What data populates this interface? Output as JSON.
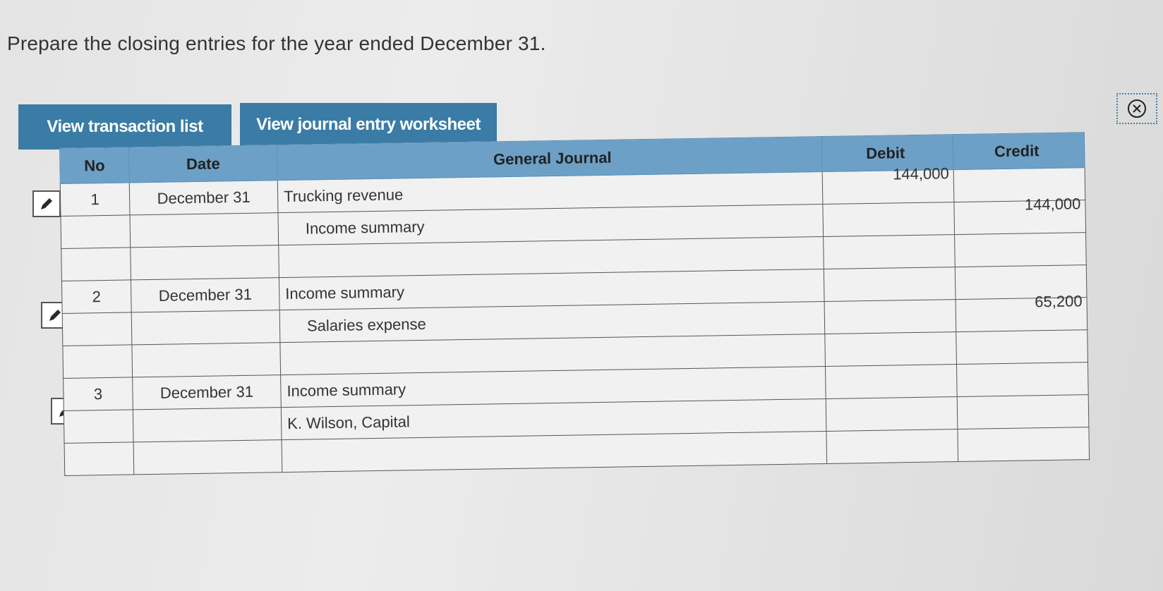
{
  "prompt": "Prepare the closing entries for the year ended December 31.",
  "buttons": {
    "transaction_list": "View transaction list",
    "journal_worksheet": "View journal entry worksheet"
  },
  "table": {
    "headers": {
      "no": "No",
      "date": "Date",
      "journal": "General Journal",
      "debit": "Debit",
      "credit": "Credit"
    },
    "rows": [
      {
        "no": "1",
        "date": "December 31",
        "account": "Trucking revenue",
        "debit": "144,000",
        "credit": ""
      },
      {
        "no": "",
        "date": "",
        "account": "Income summary",
        "debit": "",
        "credit": "144,000"
      },
      {
        "no": "",
        "date": "",
        "account": "",
        "debit": "",
        "credit": ""
      },
      {
        "no": "2",
        "date": "December 31",
        "account": "Income summary",
        "debit": "",
        "credit": ""
      },
      {
        "no": "",
        "date": "",
        "account": "Salaries expense",
        "debit": "",
        "credit": "65,200"
      },
      {
        "no": "",
        "date": "",
        "account": "",
        "debit": "",
        "credit": ""
      },
      {
        "no": "3",
        "date": "December 31",
        "account": "Income summary",
        "debit": "",
        "credit": ""
      },
      {
        "no": "",
        "date": "",
        "account": "K. Wilson, Capital",
        "debit": "",
        "credit": ""
      },
      {
        "no": "",
        "date": "",
        "account": "",
        "debit": "",
        "credit": ""
      }
    ]
  },
  "icons": {
    "edit": "pencil-icon",
    "close": "close-circle-icon"
  },
  "colors": {
    "button": "#3a7ca5",
    "header": "#6da0c6"
  }
}
